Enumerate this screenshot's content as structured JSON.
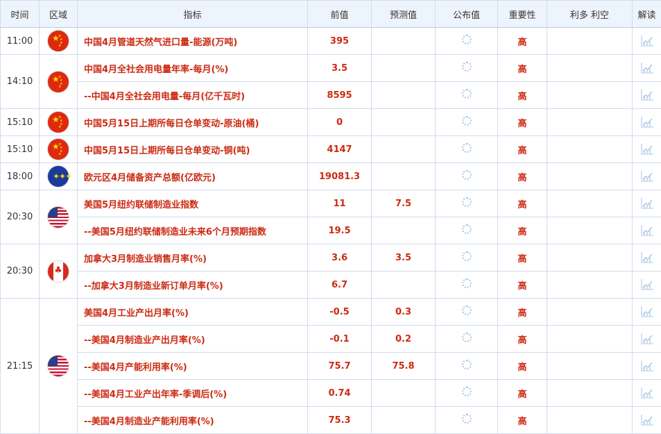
{
  "headers": {
    "time": "时间",
    "region": "区域",
    "indicator": "指标",
    "previous": "前值",
    "forecast": "预测值",
    "actual": "公布值",
    "importance": "重要性",
    "impact": "利多 利空",
    "analysis": "解读"
  },
  "groups": [
    {
      "time": "11:00",
      "flag": "china-flag",
      "rows": [
        {
          "indicator": "中国4月管道天然气进口量-能源(万吨)",
          "previous": "395",
          "forecast": "",
          "importance": "高"
        }
      ]
    },
    {
      "time": "14:10",
      "flag": "china-flag",
      "rows": [
        {
          "indicator": "中国4月全社会用电量年率-每月(%)",
          "previous": "3.5",
          "forecast": "",
          "importance": "高"
        },
        {
          "indicator": "--中国4月全社会用电量-每月(亿千瓦时)",
          "previous": "8595",
          "forecast": "",
          "importance": "高"
        }
      ]
    },
    {
      "time": "15:10",
      "flag": "china-flag",
      "rows": [
        {
          "indicator": "中国5月15日上期所每日仓单变动-原油(桶)",
          "previous": "0",
          "forecast": "",
          "importance": "高"
        }
      ]
    },
    {
      "time": "15:10",
      "flag": "china-flag",
      "rows": [
        {
          "indicator": "中国5月15日上期所每日仓单变动-铜(吨)",
          "previous": "4147",
          "forecast": "",
          "importance": "高"
        }
      ]
    },
    {
      "time": "18:00",
      "flag": "eu-flag",
      "rows": [
        {
          "indicator": "欧元区4月储备资产总额(亿欧元)",
          "previous": "19081.3",
          "forecast": "",
          "importance": "高"
        }
      ]
    },
    {
      "time": "20:30",
      "flag": "us-flag",
      "rows": [
        {
          "indicator": "美国5月纽约联储制造业指数",
          "previous": "11",
          "forecast": "7.5",
          "importance": "高"
        },
        {
          "indicator": "--美国5月纽约联储制造业未来6个月预期指数",
          "previous": "19.5",
          "forecast": "",
          "importance": "高"
        }
      ]
    },
    {
      "time": "20:30",
      "flag": "canada-flag",
      "rows": [
        {
          "indicator": "加拿大3月制造业销售月率(%)",
          "previous": "3.6",
          "forecast": "3.5",
          "importance": "高"
        },
        {
          "indicator": "--加拿大3月制造业新订单月率(%)",
          "previous": "6.7",
          "forecast": "",
          "importance": "高"
        }
      ]
    },
    {
      "time": "21:15",
      "flag": "us-flag",
      "rows": [
        {
          "indicator": "美国4月工业产出月率(%)",
          "previous": "-0.5",
          "forecast": "0.3",
          "importance": "高"
        },
        {
          "indicator": "--美国4月制造业产出月率(%)",
          "previous": "-0.1",
          "forecast": "0.2",
          "importance": "高"
        },
        {
          "indicator": "--美国4月产能利用率(%)",
          "previous": "75.7",
          "forecast": "75.8",
          "importance": "高"
        },
        {
          "indicator": "--美国4月工业产出年率-季调后(%)",
          "previous": "0.74",
          "forecast": "",
          "importance": "高"
        },
        {
          "indicator": "--美国4月制造业产能利用率(%)",
          "previous": "75.3",
          "forecast": "",
          "importance": "高"
        }
      ]
    }
  ],
  "colors": {
    "accent_red": "#cc2a12",
    "header_bg": "#eef4fc",
    "border": "#cfdcee",
    "icon_blue": "#a9c7ea"
  }
}
